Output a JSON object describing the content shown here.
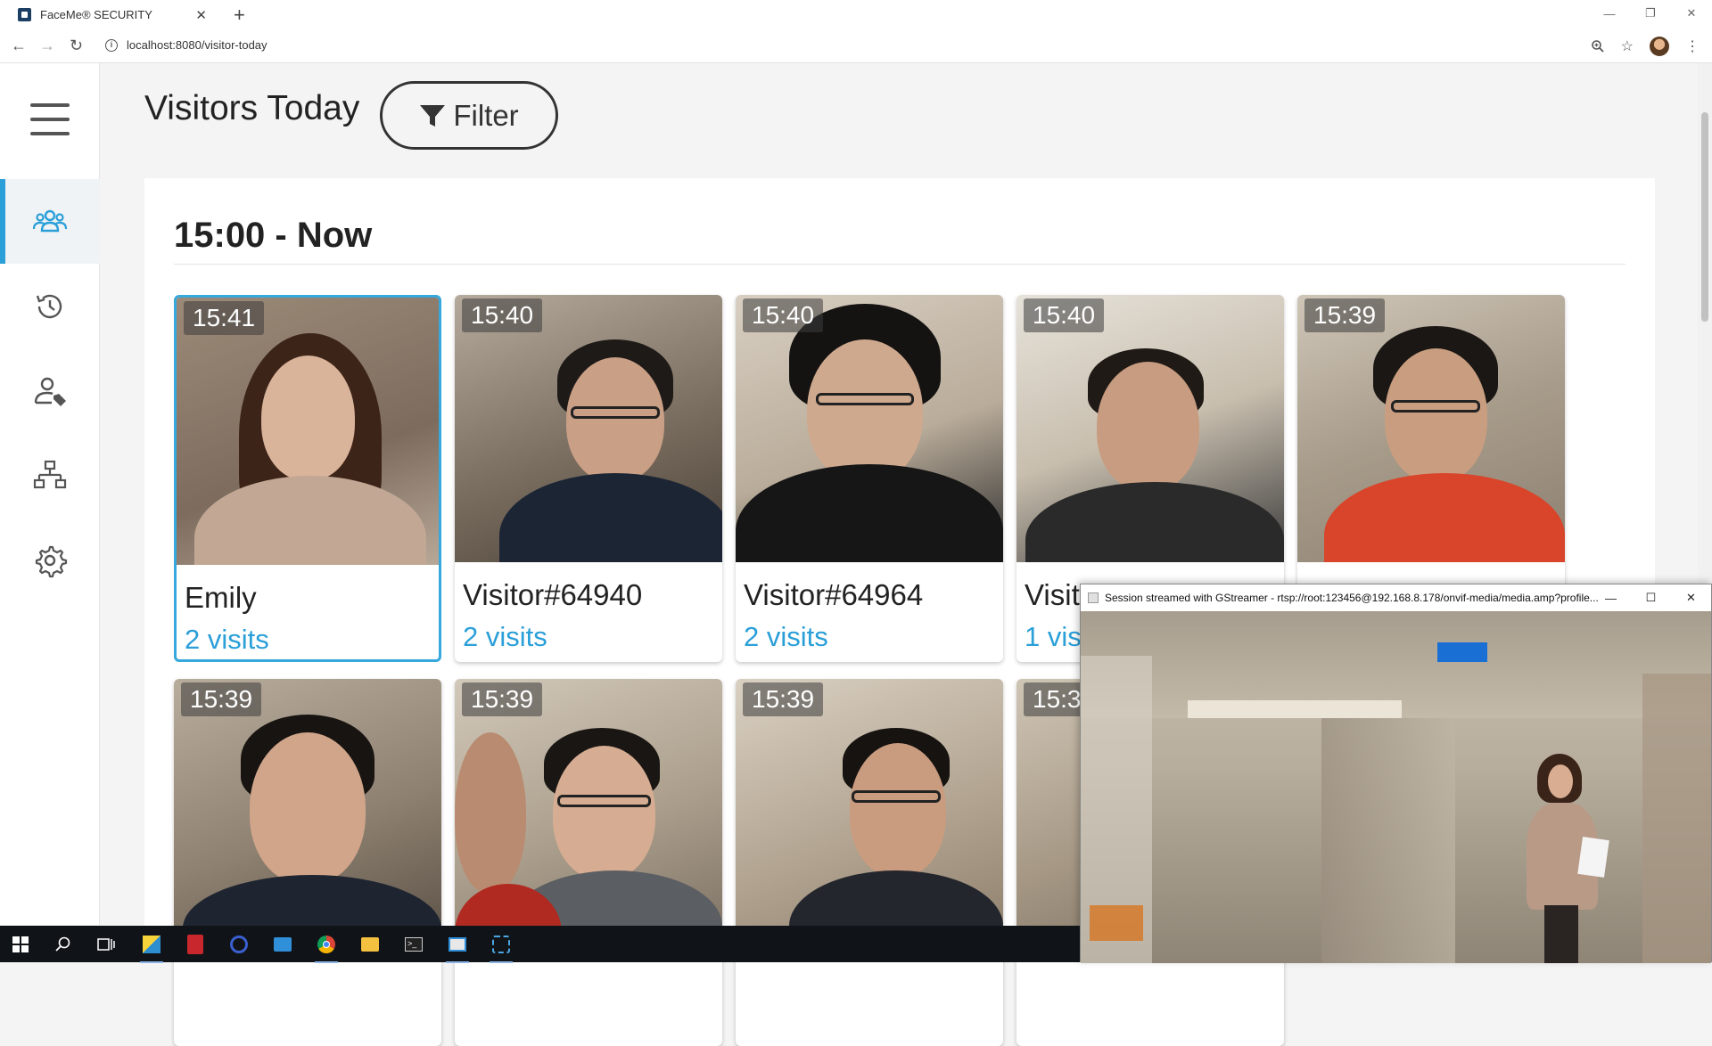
{
  "browser": {
    "tab_title": "FaceMe® SECURITY",
    "url": "localhost:8080/visitor-today"
  },
  "sidebar": {
    "items": [
      {
        "icon": "visitors-icon",
        "active": true
      },
      {
        "icon": "history-icon",
        "active": false
      },
      {
        "icon": "person-tag-icon",
        "active": false
      },
      {
        "icon": "network-icon",
        "active": false
      },
      {
        "icon": "gear-icon",
        "active": false
      }
    ]
  },
  "header": {
    "title": "Visitors Today",
    "filter_label": "Filter"
  },
  "section": {
    "title": "15:00 - Now"
  },
  "visitors": [
    {
      "time": "15:41",
      "name": "Emily",
      "visits": "2 visits"
    },
    {
      "time": "15:40",
      "name": "Visitor#64940",
      "visits": "2 visits"
    },
    {
      "time": "15:40",
      "name": "Visitor#64964",
      "visits": "2 visits"
    },
    {
      "time": "15:40",
      "name": "Visit",
      "visits": "1 vis"
    },
    {
      "time": "15:39",
      "name": "",
      "visits": ""
    },
    {
      "time": "15:39",
      "name": "",
      "visits": ""
    },
    {
      "time": "15:39",
      "name": "",
      "visits": ""
    },
    {
      "time": "15:39",
      "name": "",
      "visits": ""
    },
    {
      "time": "15:3",
      "name": "",
      "visits": ""
    }
  ],
  "video_window": {
    "title": "Session streamed with GStreamer - rtsp://root:123456@192.168.8.178/onvif-media/media.amp?profile..."
  },
  "colors": {
    "accent": "#2a9fd8",
    "selected_border": "#36a8db",
    "taskbar": "#101418"
  }
}
